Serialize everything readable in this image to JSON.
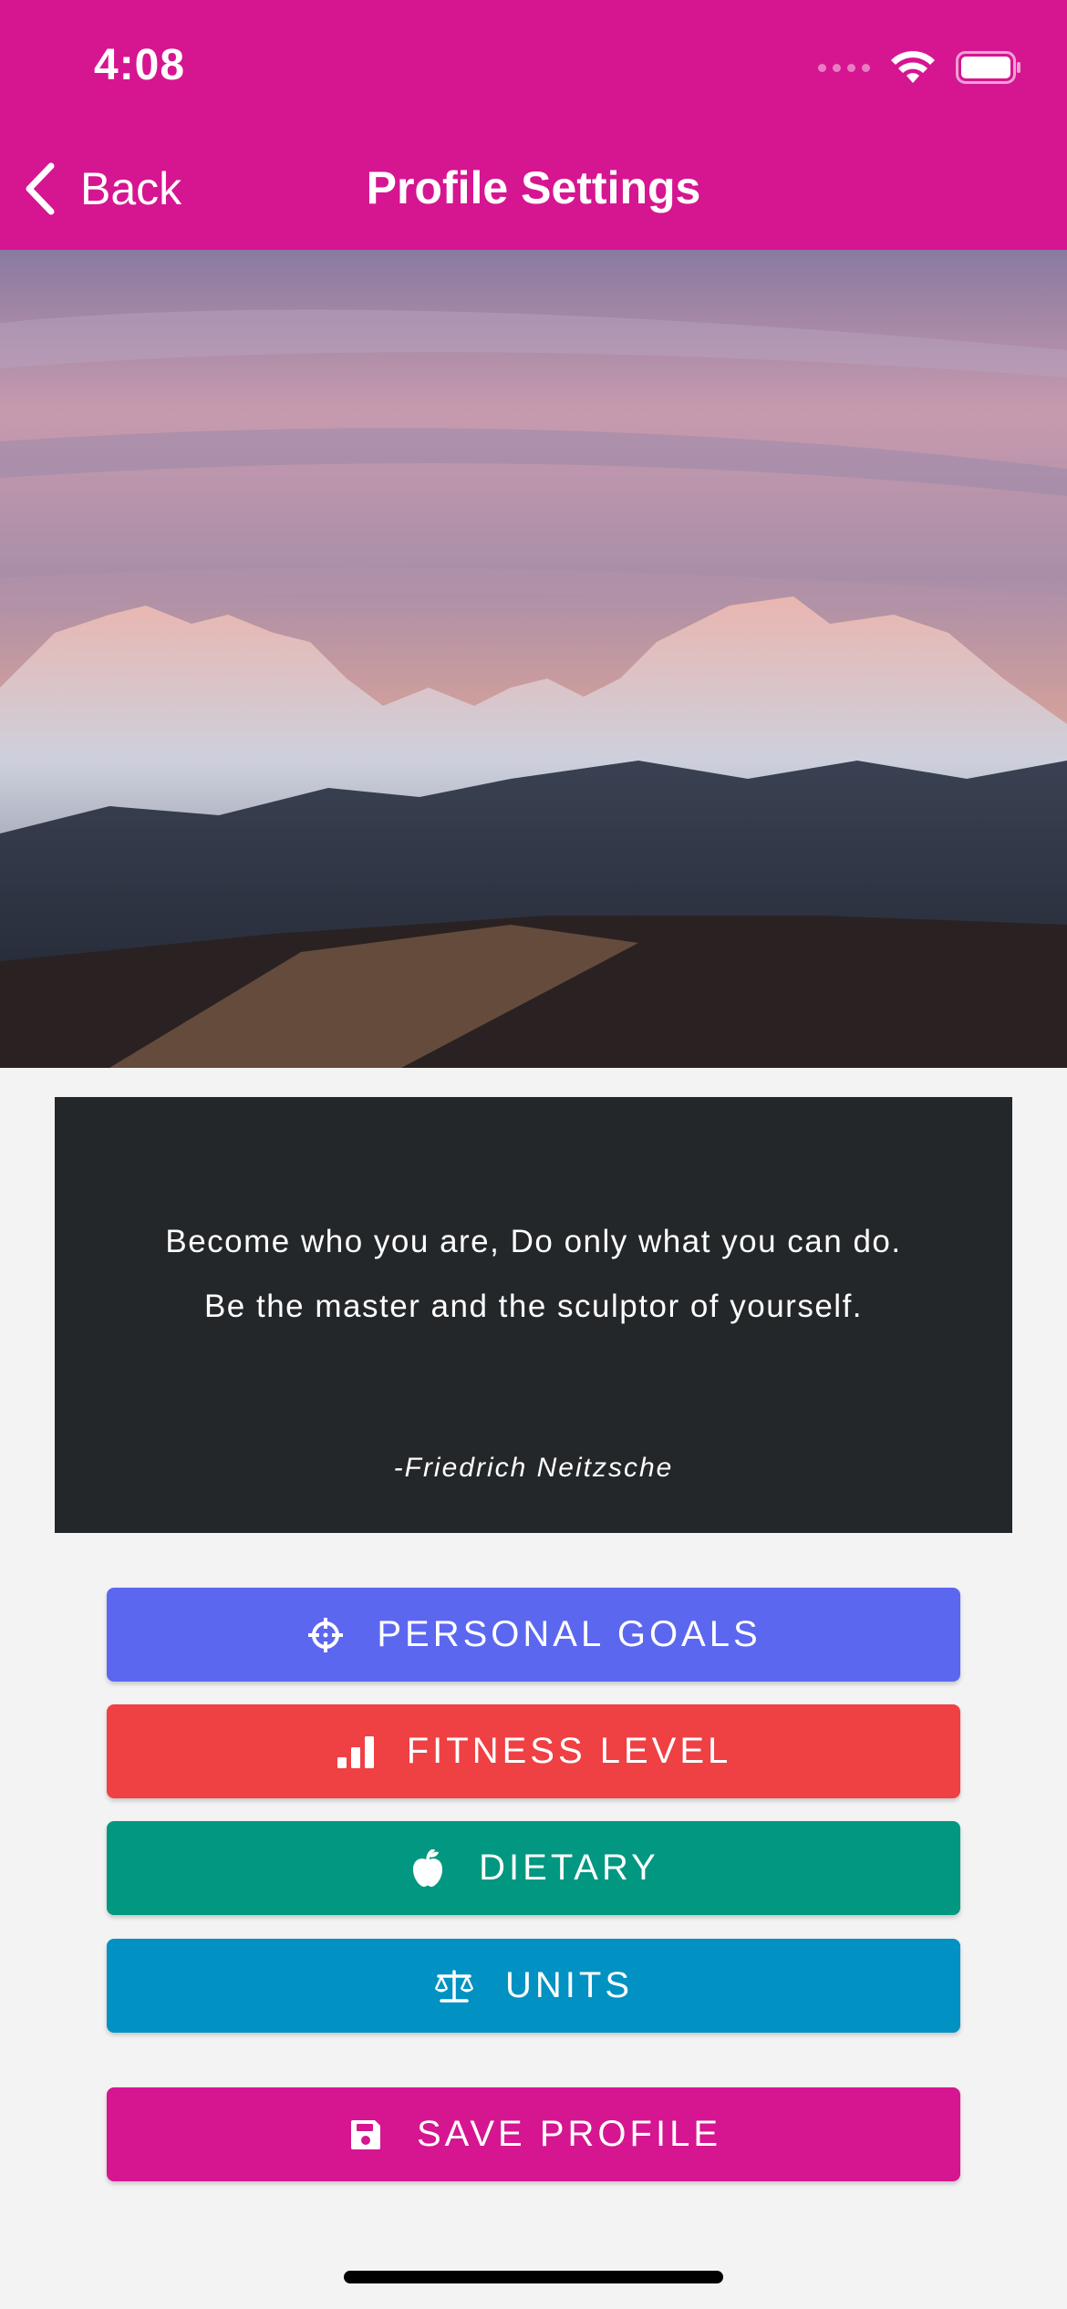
{
  "status_bar": {
    "time": "4:08"
  },
  "nav": {
    "back_label": "Back",
    "title": "Profile Settings"
  },
  "quote": {
    "text": "Become who you are, Do only what you can do. Be the master and the sculptor of yourself.",
    "author": "-Friedrich Neitzsche"
  },
  "buttons": {
    "personal_goals": "PERSONAL GOALS",
    "fitness_level": "FITNESS LEVEL",
    "dietary": "DIETARY",
    "units": "UNITS",
    "save_profile": "SAVE PROFILE"
  },
  "colors": {
    "brand": "#d61591",
    "personal_goals": "#5c67f0",
    "fitness_level": "#ef4044",
    "dietary": "#019781",
    "units": "#0191c2",
    "quote_bg": "#23272a"
  },
  "icons": {
    "personal_goals": "crosshair-icon",
    "fitness_level": "signal-bars-icon",
    "dietary": "apple-icon",
    "units": "balance-scale-icon",
    "save_profile": "floppy-disk-icon"
  }
}
